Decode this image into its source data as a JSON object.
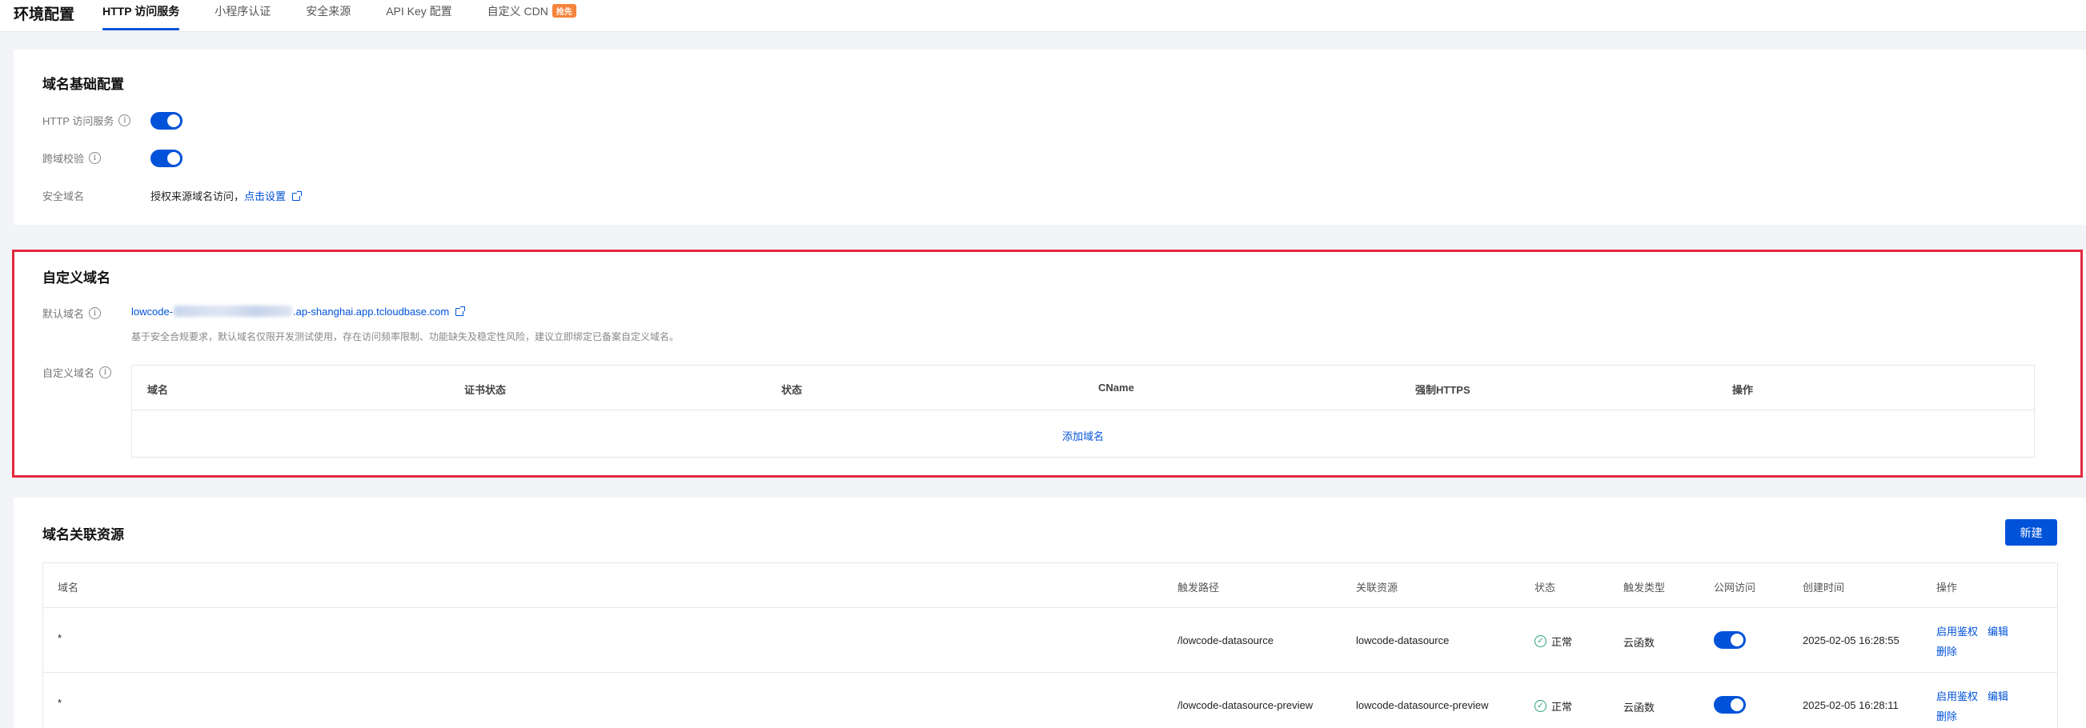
{
  "header": {
    "title": "环境配置",
    "tabs": [
      {
        "label": "HTTP 访问服务",
        "active": true
      },
      {
        "label": "小程序认证"
      },
      {
        "label": "安全来源"
      },
      {
        "label": "API Key 配置"
      },
      {
        "label": "自定义 CDN",
        "badge": "抢先"
      }
    ]
  },
  "basic": {
    "title": "域名基础配置",
    "http_label": "HTTP 访问服务",
    "cors_label": "跨域校验",
    "safe_domain_label": "安全域名",
    "safe_domain_text": "授权来源域名访问，",
    "safe_domain_link": "点击设置"
  },
  "custom": {
    "title": "自定义域名",
    "default_label": "默认域名",
    "default_prefix": "lowcode-",
    "default_suffix": ".ap-shanghai.app.tcloudbase.com",
    "hint": "基于安全合规要求，默认域名仅限开发测试使用，存在访问频率限制、功能缺失及稳定性风险，建议立即绑定已备案自定义域名。",
    "custom_label": "自定义域名",
    "columns": [
      "域名",
      "证书状态",
      "状态",
      "CName",
      "强制HTTPS",
      "操作"
    ],
    "add_label": "添加域名"
  },
  "resources": {
    "title": "域名关联资源",
    "new_button": "新建",
    "columns": [
      "域名",
      "触发路径",
      "关联资源",
      "状态",
      "触发类型",
      "公网访问",
      "创建时间",
      "操作"
    ],
    "rows": [
      {
        "domain": "*",
        "path": "/lowcode-datasource",
        "resource": "lowcode-datasource",
        "status": "正常",
        "trigger": "云函数",
        "public": true,
        "created": "2025-02-05 16:28:55",
        "op_auth": "启用鉴权",
        "op_edit": "编辑",
        "op_delete": "删除"
      },
      {
        "domain": "*",
        "path": "/lowcode-datasource-preview",
        "resource": "lowcode-datasource-preview",
        "status": "正常",
        "trigger": "云函数",
        "public": true,
        "created": "2025-02-05 16:28:11",
        "op_auth": "启用鉴权",
        "op_edit": "编辑",
        "op_delete": "删除"
      }
    ]
  },
  "colors": {
    "accent": "#0052d9",
    "highlight": "#e2293f",
    "success": "#2ba471",
    "badge": "#f5833b"
  }
}
